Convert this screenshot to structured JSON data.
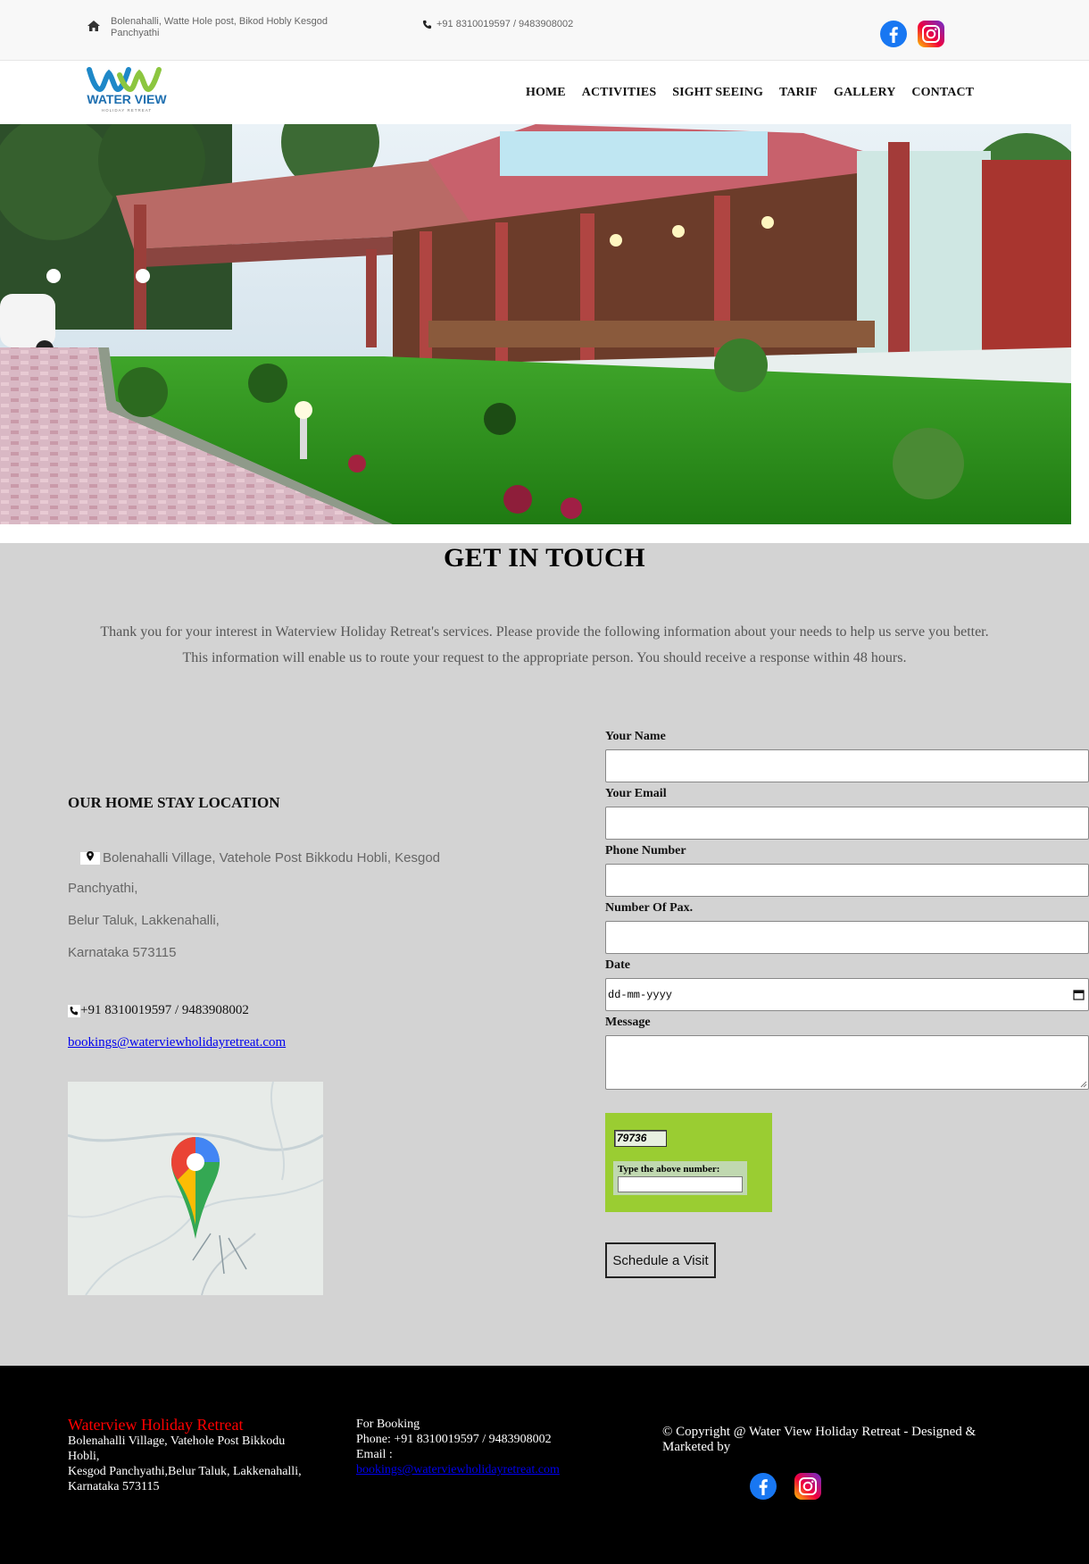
{
  "topbar": {
    "address": "Bolenahalli, Watte Hole post, Bikod Hobly Kesgod Panchyathi",
    "phone": "+91 8310019597 / 9483908002",
    "social_icons": [
      "facebook-icon",
      "instagram-icon"
    ]
  },
  "logo": {
    "brand_text": "WATER VIEW",
    "sub_text": "HOLIDAY RETREAT"
  },
  "nav": {
    "items": [
      "HOME",
      "ACTIVITIES",
      "SIGHT SEEING",
      "TARIF",
      "GALLERY",
      "CONTACT"
    ]
  },
  "contact": {
    "title": "GET IN TOUCH",
    "intro_line1": "Thank you for your interest in Waterview Holiday Retreat's services. Please provide the following information about your needs to help us serve you better.",
    "intro_line2": "This information will enable us to route your request to the appropriate person. You should receive a response within 48 hours.",
    "location": {
      "heading": "OUR HOME STAY LOCATION",
      "address_lines": [
        "Bolenahalli Village, Vatehole Post Bikkodu Hobli, Kesgod",
        "Panchyathi,",
        "Belur Taluk, Lakkenahalli,",
        "Karnataka 573115"
      ],
      "phone": "+91 8310019597 / 9483908002",
      "email": "bookings@waterviewholidayretreat.com"
    },
    "form": {
      "name_label": "Your Name",
      "email_label": "Your Email",
      "phone_label": "Phone Number",
      "pax_label": "Number Of Pax.",
      "date_label": "Date",
      "date_placeholder": "dd-mm-yyyy",
      "message_label": "Message",
      "captcha_value": "79736",
      "captcha_label": "Type the above number:",
      "submit_label": "Schedule a Visit"
    }
  },
  "footer": {
    "brand": "Waterview Holiday Retreat",
    "address_lines": [
      "Bolenahalli Village, Vatehole Post Bikkodu Hobli,",
      "Kesgod Panchyathi,Belur Taluk, Lakkenahalli,",
      "Karnataka 573115"
    ],
    "booking_heading": "For Booking",
    "booking_phone": "Phone: +91 8310019597 / 9483908002",
    "booking_email_label": "Email :",
    "booking_email": "bookings@waterviewholidayretreat.com",
    "copyright": "© Copyright @ Water View Holiday Retreat - Designed & Marketed by"
  },
  "colors": {
    "topbar_bg": "#f8f8f8",
    "section_bg": "#d3d3d3",
    "captcha_bg": "#9acd32",
    "footer_bg": "#000000",
    "footer_brand": "#ff0000",
    "link": "#0000ee",
    "facebook": "#1877f2"
  }
}
